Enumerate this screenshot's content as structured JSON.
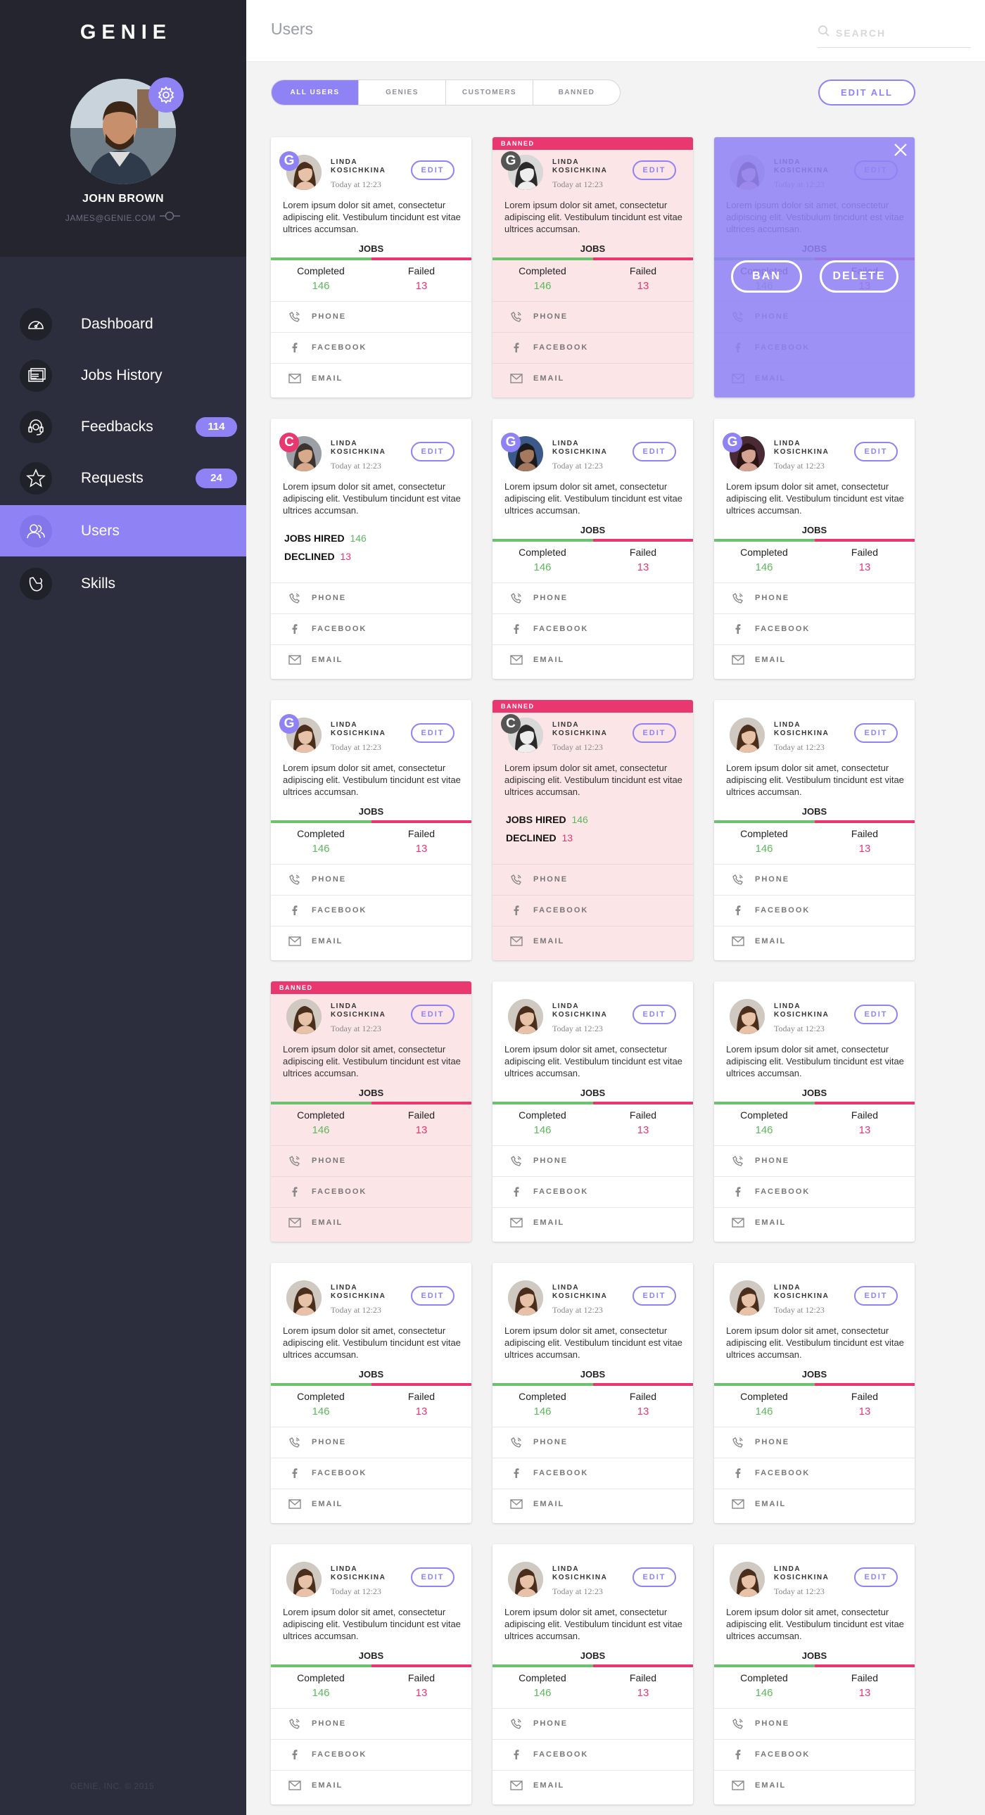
{
  "app": {
    "logo": "GENIE",
    "footer": "GENIE, INC. © 2015"
  },
  "profile": {
    "name": "JOHN BROWN",
    "email": "JAMES@GENIE.COM"
  },
  "nav": [
    {
      "label": "Dashboard",
      "icon": "speedometer-icon"
    },
    {
      "label": "Jobs History",
      "icon": "documents-icon"
    },
    {
      "label": "Feedbacks",
      "icon": "headset-icon",
      "badge": "114"
    },
    {
      "label": "Requests",
      "icon": "star-icon",
      "badge": "24"
    },
    {
      "label": "Users",
      "icon": "users-icon",
      "active": true
    },
    {
      "label": "Skills",
      "icon": "hand-icon"
    }
  ],
  "header": {
    "title": "Users",
    "search_placeholder": "SEARCH"
  },
  "tabs": [
    {
      "label": "ALL USERS",
      "active": true
    },
    {
      "label": "GENIES"
    },
    {
      "label": "CUSTOMERS"
    },
    {
      "label": "BANNED"
    }
  ],
  "edit_all": "EDIT ALL",
  "card_common": {
    "name": "LINDA KOSICHKINA",
    "time": "Today at 12:23",
    "edit": "EDIT",
    "desc": "Lorem ipsum dolor sit amet, consectetur adipiscing elit. Vestibulum tincidunt est vitae ultrices accumsan.",
    "jobs": "JOBS",
    "completed_label": "Completed",
    "failed_label": "Failed",
    "completed": "146",
    "failed": "13",
    "jobs_hired_label": "JOBS HIRED",
    "declined_label": "DECLINED",
    "phone": "PHONE",
    "facebook": "FACEBOOK",
    "email": "EMAIL",
    "banned_label": "BANNED",
    "ban_btn": "BAN",
    "delete_btn": "DELETE"
  },
  "cards": [
    {
      "role": "G",
      "role_color": "g",
      "banned": false,
      "variant": "jobs",
      "avatar": "woman"
    },
    {
      "role": "G",
      "role_color": "gray",
      "banned": true,
      "variant": "jobs",
      "avatar": "woman-bw"
    },
    {
      "role": "",
      "banned": false,
      "variant": "jobs",
      "overlay": true,
      "avatar": "woman"
    },
    {
      "role": "C",
      "role_color": "c",
      "banned": false,
      "variant": "hired",
      "avatar": "man"
    },
    {
      "role": "G",
      "role_color": "g",
      "banned": false,
      "variant": "jobs",
      "avatar": "man-dark"
    },
    {
      "role": "G",
      "role_color": "g",
      "banned": false,
      "variant": "jobs",
      "avatar": "woman-dark"
    },
    {
      "role": "G",
      "role_color": "g",
      "banned": false,
      "variant": "jobs",
      "avatar": "woman"
    },
    {
      "role": "C",
      "role_color": "gray",
      "banned": true,
      "variant": "hired",
      "avatar": "woman-bw"
    },
    {
      "role": "",
      "banned": false,
      "variant": "jobs",
      "avatar": "woman"
    },
    {
      "role": "",
      "banned": true,
      "variant": "jobs",
      "avatar": "woman"
    },
    {
      "role": "",
      "banned": false,
      "variant": "jobs",
      "avatar": "woman"
    },
    {
      "role": "",
      "banned": false,
      "variant": "jobs",
      "avatar": "woman"
    },
    {
      "role": "",
      "banned": false,
      "variant": "jobs",
      "avatar": "woman"
    },
    {
      "role": "",
      "banned": false,
      "variant": "jobs",
      "avatar": "woman"
    },
    {
      "role": "",
      "banned": false,
      "variant": "jobs",
      "avatar": "woman"
    },
    {
      "role": "",
      "banned": false,
      "variant": "jobs",
      "avatar": "woman"
    },
    {
      "role": "",
      "banned": false,
      "variant": "jobs",
      "avatar": "woman"
    },
    {
      "role": "",
      "banned": false,
      "variant": "jobs",
      "avatar": "woman"
    }
  ],
  "colors": {
    "accent": "#8f82f5",
    "danger": "#e9376f",
    "success": "#5cb85c",
    "sidebar": "#2c2e3d"
  }
}
